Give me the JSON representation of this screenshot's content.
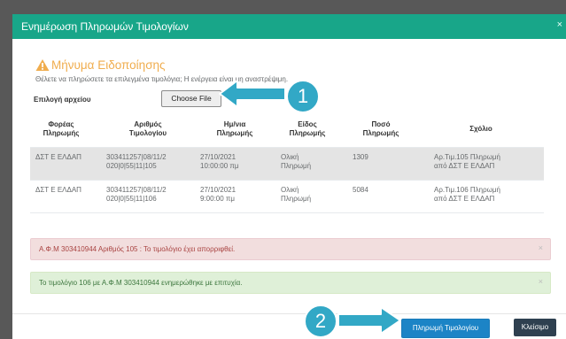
{
  "modal": {
    "title": "Ενημέρωση Πληρωμών Τιμολογίων",
    "close_glyph": "×"
  },
  "warning": {
    "title": "Μήνυμα Ειδοποίησης",
    "message": "Θέλετε να πληρώσετε τα επιλεγμένα τιμολόγια; Η ενέργεια είναι μη αναστρέψιμη."
  },
  "file": {
    "label": "Επιλογή αρχείου",
    "button_label": "Choose File"
  },
  "table": {
    "columns": [
      [
        "Φορέας",
        "Πληρωμής"
      ],
      [
        "Αριθμός",
        "Τιμολογίου"
      ],
      [
        "Ημ/νια",
        "Πληρωμής"
      ],
      [
        "Είδος",
        "Πληρωμής"
      ],
      [
        "Ποσό",
        "Πληρωμής"
      ],
      [
        "Σχόλιο",
        ""
      ]
    ],
    "rows": [
      {
        "payer": "ΔΣΤ Ε ΕΛΔΑΠ",
        "invoice": [
          "303411257|08/11/2",
          "020|0|55|11|105"
        ],
        "date": [
          "27/10/2021",
          "10:00:00 πμ"
        ],
        "type": [
          "Ολική",
          "Πληρωμή"
        ],
        "amount": "1309",
        "comment": [
          "Αρ.Τιμ.105 Πληρωμή",
          "από ΔΣΤ Ε ΕΛΔΑΠ"
        ]
      },
      {
        "payer": "ΔΣΤ Ε ΕΛΔΑΠ",
        "invoice": [
          "303411257|08/11/2",
          "020|0|55|11|106"
        ],
        "date": [
          "27/10/2021",
          "9:00:00 πμ"
        ],
        "type": [
          "Ολική",
          "Πληρωμή"
        ],
        "amount": "5084",
        "comment": [
          "Αρ.Τιμ.106 Πληρωμή",
          "από ΔΣΤ Ε ΕΛΔΑΠ"
        ]
      }
    ]
  },
  "alerts": {
    "danger": "Α.Φ.Μ 303410944 Αριθμός 105 : Το τιμολόγιο έχει απορριφθεί.",
    "success": "Το τιμολόγιο 106 με Α.Φ.Μ 303410944 ενημερώθηκε με επιτυχία.",
    "close_glyph": "×"
  },
  "footer": {
    "pay_label": "Πληρωμή Τιμολογίου",
    "close_label": "Κλείσιμο"
  },
  "callouts": {
    "one": "1",
    "two": "2"
  },
  "colors": {
    "header": "#18a689",
    "warning": "#f0ad4e",
    "primary": "#1c84c6",
    "dark": "#2f4050",
    "callout": "#32a8c6"
  },
  "icons": {
    "warning": "warning-triangle-icon",
    "arrow": "arrow-icon"
  }
}
